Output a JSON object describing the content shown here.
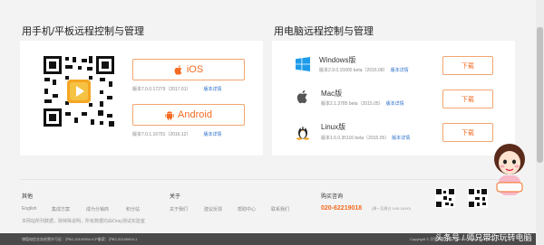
{
  "mobile": {
    "title": "用手机/平板远程控制与管理",
    "ios": {
      "label": "iOS",
      "version": "版本7.0.0.17279（2017.01）",
      "link": "版本详情"
    },
    "android": {
      "label": "Android",
      "version": "版本7.0.1.16791（2016.12）",
      "link": "版本详情"
    }
  },
  "pc": {
    "title": "用电脑远程控制与管理",
    "rows": [
      {
        "name": "Windows版",
        "version": "版本2.9.0.15000 beta（2016.08）",
        "link": "版本详情",
        "button": "下载",
        "icon": "windows-icon"
      },
      {
        "name": "Mac版",
        "version": "版本2.1.3785 beta（2015.05）",
        "link": "版本详情",
        "button": "下载",
        "icon": "apple-icon"
      },
      {
        "name": "Linux版",
        "version": "版本1.6.0.35116 beta（2015.05）",
        "link": "版本详情",
        "button": "下载",
        "icon": "linux-icon"
      }
    ]
  },
  "footer": {
    "others": {
      "heading": "其他",
      "links": [
        "English",
        "集成方案",
        "成为分销商",
        "积分站"
      ]
    },
    "about": {
      "heading": "关于",
      "links": [
        "关于我们",
        "建议反馈",
        "帮助中心",
        "联系我们"
      ]
    },
    "contact": {
      "heading": "购买咨询",
      "phone": "020-62219018",
      "hours": "(周一至周五 9:00-18:00)"
    },
    "note": "本网站所列数据，除特殊说明，所有数据均由Oray测试实验室",
    "bottom_left": "增值电信业务经营许可证：沪B2-20100904  ICP备案：沪B2-20100904-1",
    "bottom_right": "Copyright © 贝锐科技 Oray.com. All Rights Reserved.",
    "watermark": "头条号 / 师兄带你玩转电脑"
  },
  "colors": {
    "accent": "#f36b21",
    "link": "#2a6fc9",
    "border": "#f3a56f"
  }
}
